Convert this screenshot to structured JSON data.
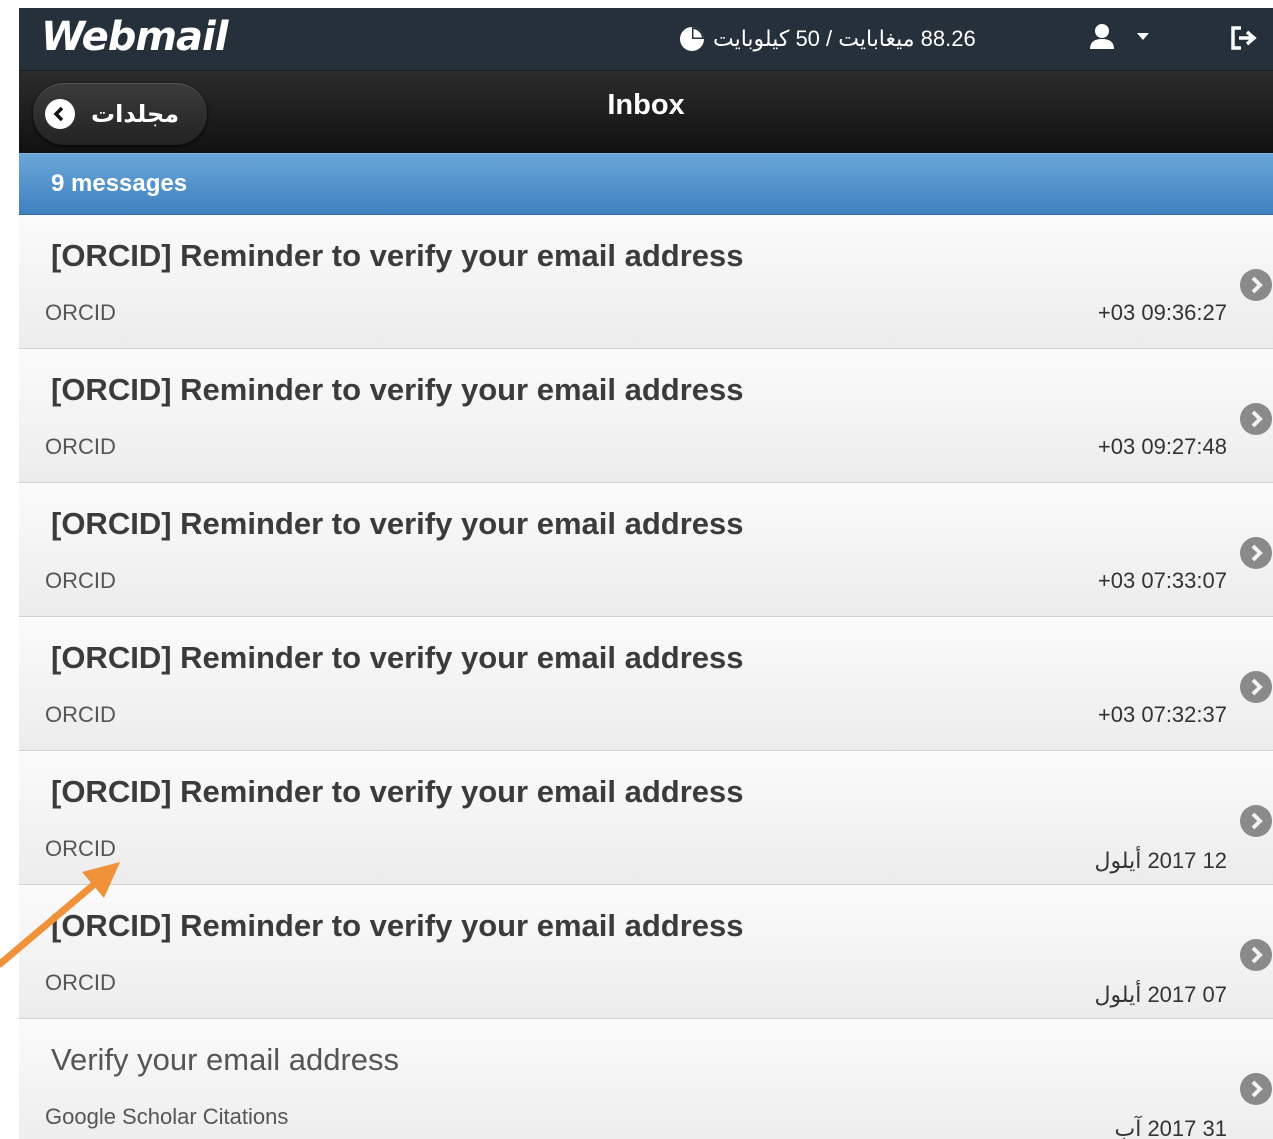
{
  "header": {
    "logo": "Webmail",
    "quota_text": "88.26 ميغابايت / 50 كيلوبايت",
    "icons": {
      "quota": "pie-chart-icon",
      "user": "user-icon",
      "dropdown": "caret-down-icon",
      "logout": "logout-icon"
    }
  },
  "toolbar": {
    "back_label": "مجلدات",
    "title": "Inbox"
  },
  "inbox": {
    "count_text": "9 messages",
    "messages": [
      {
        "subject": "[ORCID] Reminder to verify your email address",
        "sender": "ORCID",
        "date": "+03 09:36:27",
        "unread": true
      },
      {
        "subject": "[ORCID] Reminder to verify your email address",
        "sender": "ORCID",
        "date": "+03 09:27:48",
        "unread": true
      },
      {
        "subject": "[ORCID] Reminder to verify your email address",
        "sender": "ORCID",
        "date": "+03 07:33:07",
        "unread": true
      },
      {
        "subject": "[ORCID] Reminder to verify your email address",
        "sender": "ORCID",
        "date": "+03 07:32:37",
        "unread": true
      },
      {
        "subject": "[ORCID] Reminder to verify your email address",
        "sender": "ORCID",
        "date": "12 2017 أيلول",
        "unread": true
      },
      {
        "subject": "[ORCID] Reminder to verify your email address",
        "sender": "ORCID",
        "date": "07 2017 أيلول",
        "unread": true
      },
      {
        "subject": "Verify your email address",
        "sender": "Google Scholar Citations",
        "date": "31 2017 آب",
        "unread": false
      }
    ]
  },
  "colors": {
    "topbar": "#25303a",
    "headerbar": "#1a1a1a",
    "countbar": "#4f8fcb",
    "annotation_arrow": "#f0923a"
  }
}
